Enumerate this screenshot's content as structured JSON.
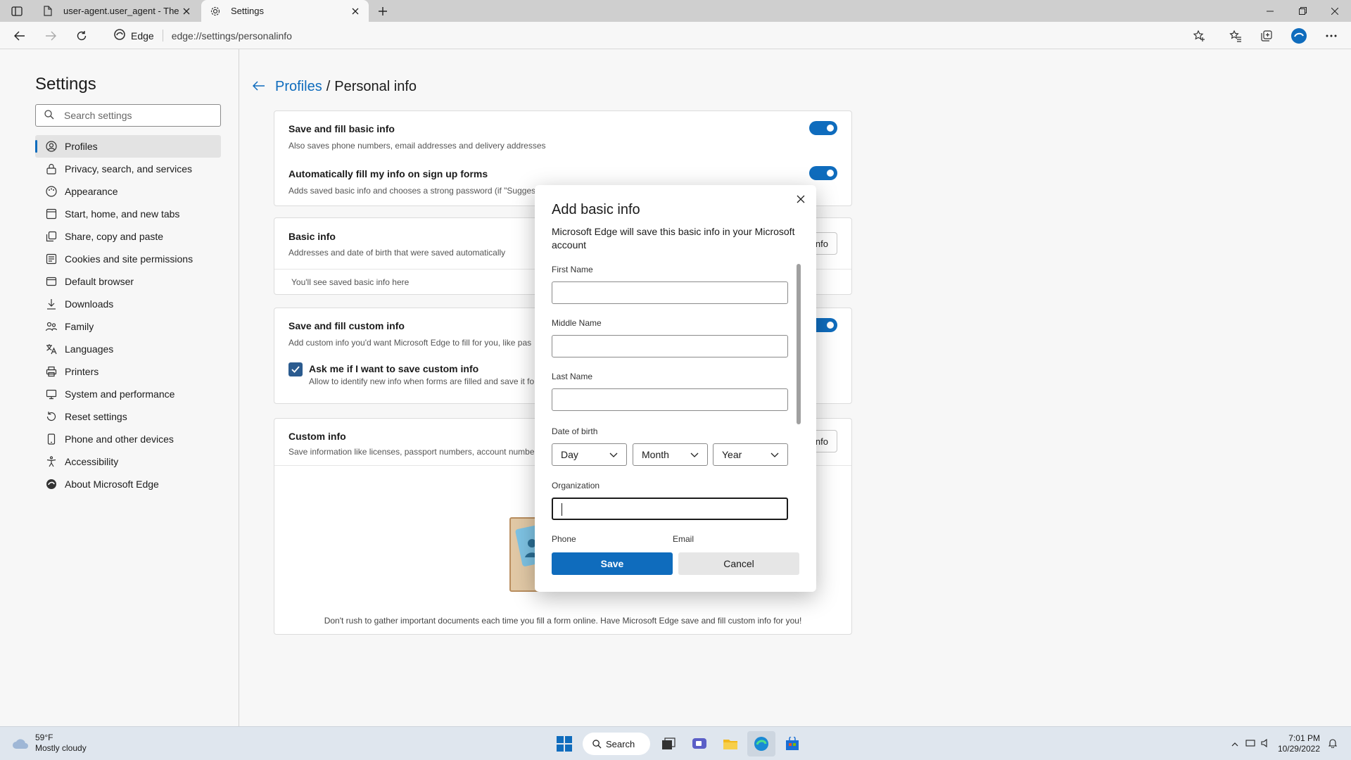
{
  "browser": {
    "tabs": [
      {
        "title": "user-agent.user_agent - The Coll",
        "active": false
      },
      {
        "title": "Settings",
        "active": true
      }
    ],
    "address": {
      "site": "Edge",
      "url": "edge://settings/personalinfo"
    }
  },
  "sidebar": {
    "title": "Settings",
    "search_placeholder": "Search settings",
    "items": [
      {
        "label": "Profiles",
        "icon": "profile-icon"
      },
      {
        "label": "Privacy, search, and services",
        "icon": "lock-icon"
      },
      {
        "label": "Appearance",
        "icon": "appearance-icon"
      },
      {
        "label": "Start, home, and new tabs",
        "icon": "home-icon"
      },
      {
        "label": "Share, copy and paste",
        "icon": "share-icon"
      },
      {
        "label": "Cookies and site permissions",
        "icon": "cookie-icon"
      },
      {
        "label": "Default browser",
        "icon": "browser-icon"
      },
      {
        "label": "Downloads",
        "icon": "download-icon"
      },
      {
        "label": "Family",
        "icon": "family-icon"
      },
      {
        "label": "Languages",
        "icon": "language-icon"
      },
      {
        "label": "Printers",
        "icon": "printer-icon"
      },
      {
        "label": "System and performance",
        "icon": "system-icon"
      },
      {
        "label": "Reset settings",
        "icon": "reset-icon"
      },
      {
        "label": "Phone and other devices",
        "icon": "phone-icon"
      },
      {
        "label": "Accessibility",
        "icon": "accessibility-icon"
      },
      {
        "label": "About Microsoft Edge",
        "icon": "edge-logo-icon"
      }
    ]
  },
  "main": {
    "breadcrumb_link": "Profiles",
    "breadcrumb_sep": "/",
    "breadcrumb_current": "Personal info",
    "save_fill": {
      "title": "Save and fill basic info",
      "desc": "Also saves phone numbers, email addresses and delivery addresses"
    },
    "auto_fill": {
      "title": "Automatically fill my info on sign up forms",
      "desc": "Adds saved basic info and chooses a strong password (if \"Suggest"
    },
    "basic_info": {
      "title": "Basic info",
      "desc": "Addresses and date of birth that were saved automatically",
      "button": "nfo",
      "empty": "You'll see saved basic info here"
    },
    "custom_fill": {
      "title": "Save and fill custom info",
      "desc": "Add custom info you'd want Microsoft Edge to fill for you, like pas"
    },
    "ask_me": {
      "title": "Ask me if I want to save custom info",
      "desc": "Allow to identify new info when forms are filled and save it fo"
    },
    "custom_info": {
      "title": "Custom info",
      "desc": "Save information like licenses, passport numbers, account number",
      "button": "nfo",
      "footer": "Don't rush to gather important documents each time you fill a form online. Have Microsoft Edge save and fill custom info for you!"
    }
  },
  "dialog": {
    "title": "Add basic info",
    "subtitle": "Microsoft Edge will save this basic info in your Microsoft account",
    "first_name_label": "First Name",
    "first_name_value": "",
    "middle_name_label": "Middle Name",
    "middle_name_value": "",
    "last_name_label": "Last Name",
    "last_name_value": "",
    "dob_label": "Date of birth",
    "day": "Day",
    "month": "Month",
    "year": "Year",
    "org_label": "Organization",
    "org_value": "",
    "phone_label": "Phone",
    "email_label": "Email",
    "save": "Save",
    "cancel": "Cancel"
  },
  "taskbar": {
    "temp": "59°F",
    "weather": "Mostly cloudy",
    "search": "Search",
    "time": "7:01 PM",
    "date": "10/29/2022"
  },
  "colors": {
    "accent": "#0f6cbd",
    "nav_active": "#e3e3e3",
    "taskbar": "#dfe6ee"
  }
}
